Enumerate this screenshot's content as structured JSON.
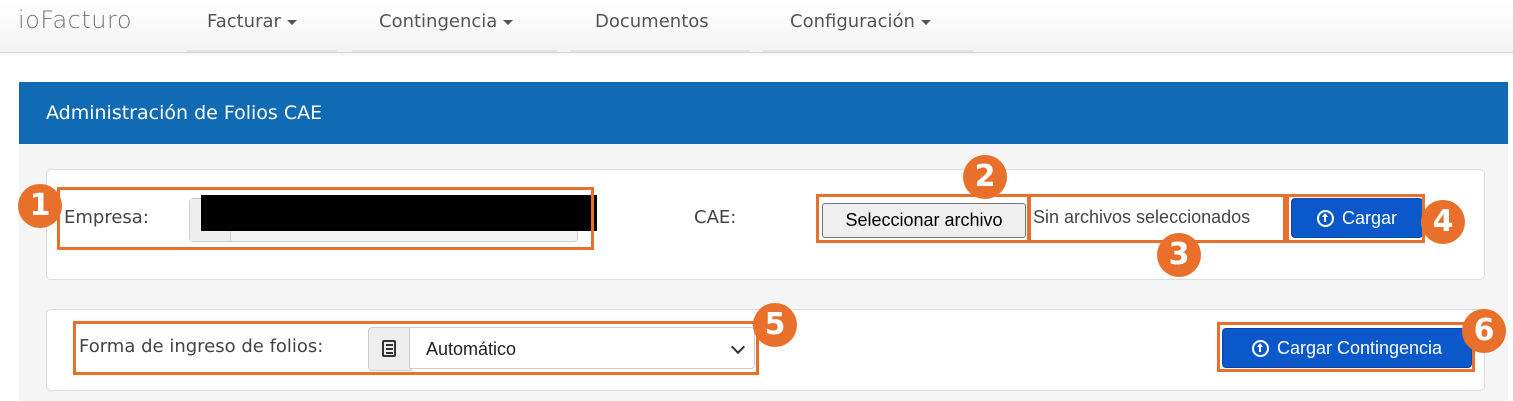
{
  "nav": {
    "brand": "ioFacturo",
    "items": [
      {
        "label": "Facturar",
        "dropdown": true
      },
      {
        "label": "Contingencia",
        "dropdown": true
      },
      {
        "label": "Documentos",
        "dropdown": false
      },
      {
        "label": "Configuración",
        "dropdown": true
      }
    ]
  },
  "panel": {
    "title": "Administración de Folios CAE"
  },
  "cae_form": {
    "empresa_label": "Empresa:",
    "cae_label": "CAE:",
    "file_button": "Seleccionar archivo",
    "file_status": "Sin archivos seleccionados",
    "upload_button": "Cargar"
  },
  "folios_form": {
    "label": "Forma de ingreso de folios:",
    "selected": "Automático",
    "contingency_button": "Cargar Contingencia"
  },
  "annotations": [
    "1",
    "2",
    "3",
    "4",
    "5",
    "6"
  ],
  "colors": {
    "header_blue": "#106bb4",
    "button_blue": "#0a58ca",
    "annotation_orange": "#e8702a"
  }
}
